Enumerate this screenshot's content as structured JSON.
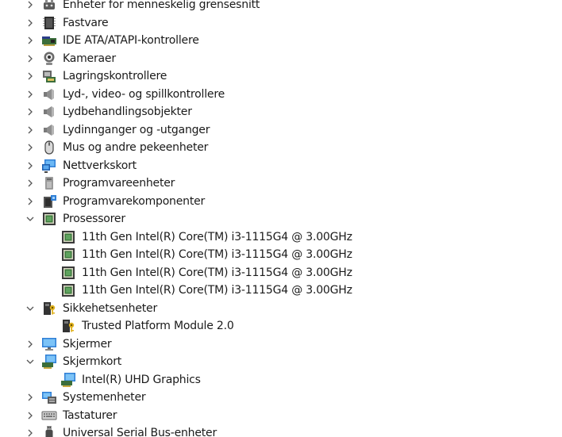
{
  "tree": [
    {
      "label": "Enheter for menneskelig grensesnitt",
      "icon": "hid-icon",
      "level": 0,
      "expanded": false
    },
    {
      "label": "Fastvare",
      "icon": "firmware-icon",
      "level": 0,
      "expanded": false
    },
    {
      "label": "IDE ATA/ATAPI-kontrollere",
      "icon": "ide-controller-icon",
      "level": 0,
      "expanded": false
    },
    {
      "label": "Kameraer",
      "icon": "camera-icon",
      "level": 0,
      "expanded": false
    },
    {
      "label": "Lagringskontrollere",
      "icon": "storage-controller-icon",
      "level": 0,
      "expanded": false
    },
    {
      "label": "Lyd-, video- og spillkontrollere",
      "icon": "speaker-icon",
      "level": 0,
      "expanded": false
    },
    {
      "label": "Lydbehandlingsobjekter",
      "icon": "speaker-icon",
      "level": 0,
      "expanded": false
    },
    {
      "label": "Lydinnganger og -utganger",
      "icon": "speaker-icon",
      "level": 0,
      "expanded": false
    },
    {
      "label": "Mus og andre pekeenheter",
      "icon": "mouse-icon",
      "level": 0,
      "expanded": false
    },
    {
      "label": "Nettverkskort",
      "icon": "network-adapter-icon",
      "level": 0,
      "expanded": false
    },
    {
      "label": "Programvareenheter",
      "icon": "software-device-icon",
      "level": 0,
      "expanded": false
    },
    {
      "label": "Programvarekomponenter",
      "icon": "software-component-icon",
      "level": 0,
      "expanded": false
    },
    {
      "label": "Prosessorer",
      "icon": "processor-icon",
      "level": 0,
      "expanded": true
    },
    {
      "label": "11th Gen Intel(R) Core(TM) i3-1115G4 @ 3.00GHz",
      "icon": "processor-icon",
      "level": 1
    },
    {
      "label": "11th Gen Intel(R) Core(TM) i3-1115G4 @ 3.00GHz",
      "icon": "processor-icon",
      "level": 1
    },
    {
      "label": "11th Gen Intel(R) Core(TM) i3-1115G4 @ 3.00GHz",
      "icon": "processor-icon",
      "level": 1
    },
    {
      "label": "11th Gen Intel(R) Core(TM) i3-1115G4 @ 3.00GHz",
      "icon": "processor-icon",
      "level": 1
    },
    {
      "label": "Sikkehetsenheter",
      "icon": "security-device-icon",
      "level": 0,
      "expanded": true
    },
    {
      "label": "Trusted Platform Module 2.0",
      "icon": "security-device-icon",
      "level": 1
    },
    {
      "label": "Skjermer",
      "icon": "monitor-icon",
      "level": 0,
      "expanded": false
    },
    {
      "label": "Skjermkort",
      "icon": "display-adapter-icon",
      "level": 0,
      "expanded": true
    },
    {
      "label": "Intel(R) UHD Graphics",
      "icon": "display-adapter-icon",
      "level": 1
    },
    {
      "label": "Systemenheter",
      "icon": "system-device-icon",
      "level": 0,
      "expanded": false
    },
    {
      "label": "Tastaturer",
      "icon": "keyboard-icon",
      "level": 0,
      "expanded": false
    },
    {
      "label": "Universal Serial Bus-enheter",
      "icon": "usb-icon",
      "level": 0,
      "expanded": false
    }
  ]
}
